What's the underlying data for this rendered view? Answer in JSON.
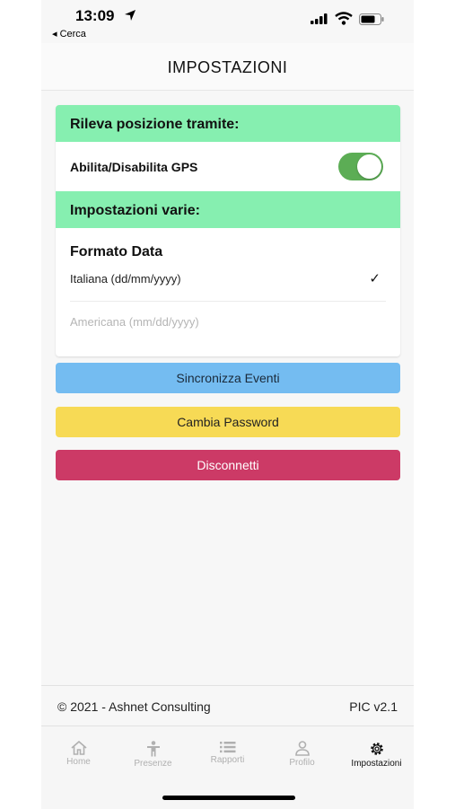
{
  "status_bar": {
    "time": "13:09",
    "back_label": "◂ Cerca"
  },
  "header": {
    "title": "IMPOSTAZIONI"
  },
  "location_section": {
    "heading": "Rileva posizione tramite:",
    "gps_label": "Abilita/Disabilita GPS",
    "gps_enabled": true
  },
  "misc_section": {
    "heading": "Impostazioni varie:",
    "date_format_title": "Formato Data",
    "options": [
      {
        "label": "Italiana (dd/mm/yyyy)",
        "selected": true
      },
      {
        "label": "Americana (mm/dd/yyyy)",
        "selected": false
      }
    ],
    "check_glyph": "✓"
  },
  "buttons": {
    "sync": "Sincronizza Eventi",
    "password": "Cambia Password",
    "logout": "Disconnetti"
  },
  "footer": {
    "copyright": "© 2021 - Ashnet Consulting",
    "version": "PIC v2.1"
  },
  "tabs": [
    {
      "label": "Home",
      "icon": "home-icon"
    },
    {
      "label": "Presenze",
      "icon": "person-icon"
    },
    {
      "label": "Rapporti",
      "icon": "list-icon"
    },
    {
      "label": "Profilo",
      "icon": "user-icon"
    },
    {
      "label": "Impostazioni",
      "icon": "gear-icon",
      "active": true
    }
  ],
  "colors": {
    "section_header": "#86efb0",
    "toggle_on": "#5cad55",
    "sync_button": "#74bcf1",
    "password_button": "#f7da55",
    "logout_button": "#cc3a66",
    "tab_inactive": "#b0b0b0",
    "tab_active": "#111111"
  }
}
